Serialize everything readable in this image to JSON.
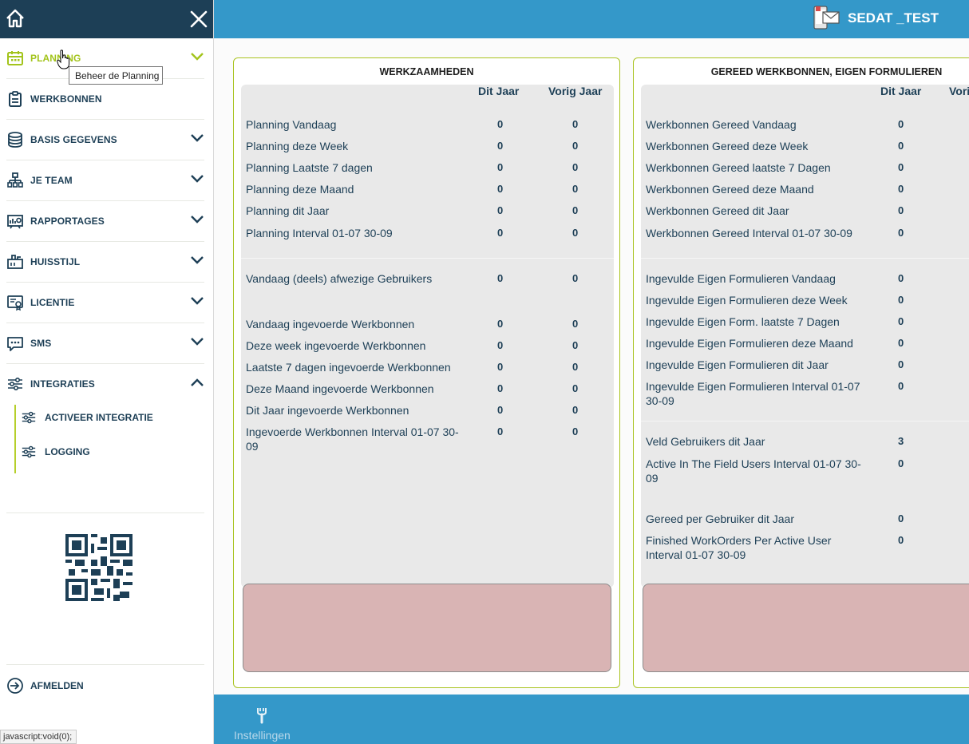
{
  "header": {
    "user_name": "SEDAT _TEST"
  },
  "sidebar": {
    "items": [
      {
        "label": "PLANNING",
        "icon": "calendar-icon",
        "chevron": "down",
        "active": true
      },
      {
        "label": "WERKBONNEN",
        "icon": "clipboard-icon"
      },
      {
        "label": "BASIS GEGEVENS",
        "icon": "database-icon",
        "chevron": "down"
      },
      {
        "label": "JE TEAM",
        "icon": "team-icon",
        "chevron": "down"
      },
      {
        "label": "RAPPORTAGES",
        "icon": "report-icon",
        "chevron": "down"
      },
      {
        "label": "HUISSTIJL",
        "icon": "brush-icon",
        "chevron": "down"
      },
      {
        "label": "LICENTIE",
        "icon": "license-icon",
        "chevron": "down"
      },
      {
        "label": "SMS",
        "icon": "sms-icon",
        "chevron": "down"
      },
      {
        "label": "INTEGRATIES",
        "icon": "sliders-icon",
        "chevron": "up"
      }
    ],
    "sub_items": [
      {
        "label": "ACTIVEER INTEGRATIE",
        "icon": "sliders-icon"
      },
      {
        "label": "LOGGING",
        "icon": "sliders-icon"
      }
    ],
    "logout_label": "AFMELDEN",
    "tooltip": "Beheer de Planning"
  },
  "status_bar": {
    "text": "javascript:void(0);"
  },
  "panel_left": {
    "title": "WERKZAAMHEDEN",
    "col1": "Dit Jaar",
    "col2": "Vorig Jaar",
    "rows": [
      {
        "label": "Planning Vandaag",
        "v1": "0",
        "v2": "0"
      },
      {
        "label": "Planning deze Week",
        "v1": "0",
        "v2": "0"
      },
      {
        "label": "Planning Laatste 7 dagen",
        "v1": "0",
        "v2": "0"
      },
      {
        "label": "Planning deze Maand",
        "v1": "0",
        "v2": "0"
      },
      {
        "label": "Planning dit Jaar",
        "v1": "0",
        "v2": "0"
      },
      {
        "label": "Planning Interval 01-07 30-09",
        "v1": "0",
        "v2": "0"
      },
      {
        "label": "Vandaag (deels) afwezige Gebruikers",
        "v1": "0",
        "v2": "0"
      },
      {
        "label": "Vandaag ingevoerde Werkbonnen",
        "v1": "0",
        "v2": "0"
      },
      {
        "label": "Deze week ingevoerde Werkbonnen",
        "v1": "0",
        "v2": "0"
      },
      {
        "label": "Laatste 7 dagen ingevoerde Werkbonnen",
        "v1": "0",
        "v2": "0"
      },
      {
        "label": "Deze Maand ingevoerde Werkbonnen",
        "v1": "0",
        "v2": "0"
      },
      {
        "label": "Dit Jaar ingevoerde Werkbonnen",
        "v1": "0",
        "v2": "0"
      },
      {
        "label": "Ingevoerde Werkbonnen Interval 01-07 30-09",
        "v1": "0",
        "v2": "0"
      }
    ]
  },
  "panel_right": {
    "title": "GEREED WERKBONNEN, EIGEN FORMULIEREN",
    "col1": "Dit Jaar",
    "col2": "Vorig Jaar",
    "rows": [
      {
        "label": "Werkbonnen Gereed Vandaag",
        "v1": "0"
      },
      {
        "label": "Werkbonnen Gereed deze Week",
        "v1": "0"
      },
      {
        "label": "Werkbonnen Gereed laatste 7 Dagen",
        "v1": "0"
      },
      {
        "label": "Werkbonnen Gereed deze Maand",
        "v1": "0"
      },
      {
        "label": "Werkbonnen Gereed dit Jaar",
        "v1": "0"
      },
      {
        "label": "Werkbonnen Gereed Interval 01-07 30-09",
        "v1": "0"
      },
      {
        "label": "Ingevulde Eigen Formulieren Vandaag",
        "v1": "0"
      },
      {
        "label": "Ingevulde Eigen Formulieren deze Week",
        "v1": "0"
      },
      {
        "label": "Ingevulde Eigen Form. laatste 7 Dagen",
        "v1": "0"
      },
      {
        "label": "Ingevulde Eigen Formulieren deze Maand",
        "v1": "0"
      },
      {
        "label": "Ingevulde Eigen Formulieren dit Jaar",
        "v1": "0"
      },
      {
        "label": "Ingevulde Eigen Formulieren Interval 01-07 30-09",
        "v1": "0"
      },
      {
        "label": "Veld Gebruikers dit Jaar",
        "v1": "3"
      },
      {
        "label": "Active In The Field Users Interval 01-07 30-09",
        "v1": "0"
      },
      {
        "label": "Gereed per Gebruiker dit Jaar",
        "v1": "0"
      },
      {
        "label": "Finished WorkOrders Per Active User Interval 01-07 30-09",
        "v1": "0"
      }
    ]
  },
  "footer": {
    "settings_label": "Instellingen"
  },
  "colors": {
    "brand_dark": "#1d3f56",
    "accent_green": "#a3c41c",
    "bar_blue": "#3498c9"
  }
}
